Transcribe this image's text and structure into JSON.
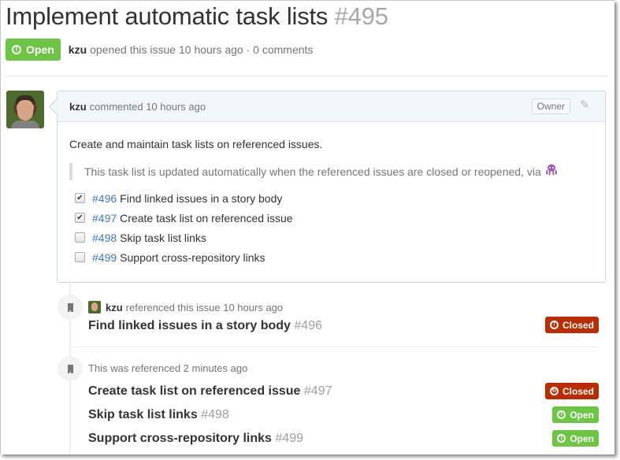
{
  "issue": {
    "title": "Implement automatic task lists",
    "number": "#495",
    "state_label": "Open",
    "author": "kzu",
    "opened_text": "opened this issue 10 hours ago · 0 comments"
  },
  "comment": {
    "author": "kzu",
    "action_text": "commented 10 hours ago",
    "role_badge": "Owner",
    "body_text": "Create and maintain task lists on referenced issues.",
    "quote_text": "This task list is updated automatically when the referenced issues are closed or reopened, via",
    "tasks": [
      {
        "number": "#496",
        "label": "Find linked issues in a story body",
        "checked": true
      },
      {
        "number": "#497",
        "label": "Create task list on referenced issue",
        "checked": true
      },
      {
        "number": "#498",
        "label": "Skip task list links",
        "checked": false
      },
      {
        "number": "#499",
        "label": "Support cross-repository links",
        "checked": false
      }
    ]
  },
  "events": [
    {
      "author": "kzu",
      "text": "referenced this issue 10 hours ago",
      "refs": [
        {
          "title": "Find linked issues in a story body",
          "number": "#496",
          "state": "Closed"
        }
      ]
    },
    {
      "text": "This was referenced 2 minutes ago",
      "refs": [
        {
          "title": "Create task list on referenced issue",
          "number": "#497",
          "state": "Closed"
        },
        {
          "title": "Skip task list links",
          "number": "#498",
          "state": "Open"
        },
        {
          "title": "Support cross-repository links",
          "number": "#499",
          "state": "Open"
        }
      ]
    }
  ],
  "colors": {
    "open": "#6cc644",
    "closed": "#bd2c00",
    "link": "#4078c0"
  }
}
